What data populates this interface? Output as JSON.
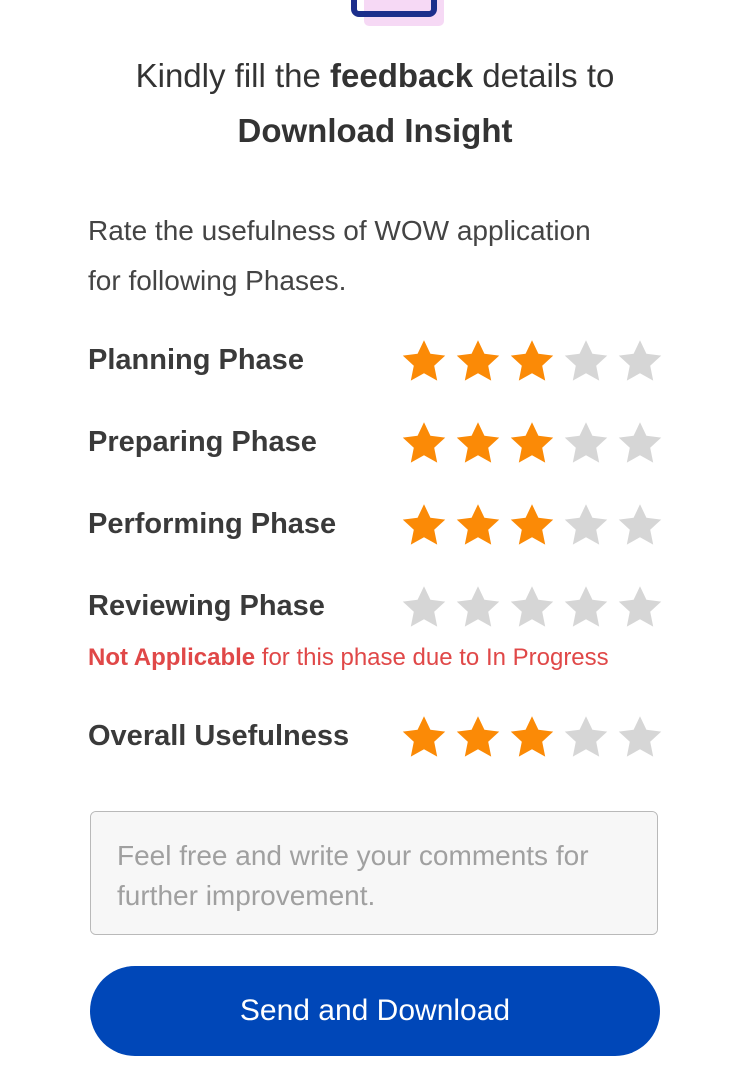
{
  "header": {
    "title_part1": "Kindly fill the ",
    "title_bold1": "feedback",
    "title_part2": " details to",
    "title_bold2": "Download Insight"
  },
  "prompt": {
    "line1": "Rate the usefulness of WOW application",
    "line2": "for following Phases."
  },
  "colors": {
    "star_filled": "#fb8a06",
    "star_empty": "#d6d6d6",
    "accent": "#0047b8",
    "note": "#e04848"
  },
  "ratings": [
    {
      "label": "Planning Phase",
      "rating": 3,
      "max": 5
    },
    {
      "label": "Preparing Phase",
      "rating": 3,
      "max": 5
    },
    {
      "label": "Performing Phase",
      "rating": 3,
      "max": 5
    },
    {
      "label": "Reviewing Phase",
      "rating": 0,
      "max": 5
    },
    {
      "label": "Overall Usefulness",
      "rating": 3,
      "max": 5
    }
  ],
  "reviewing_note": {
    "bold": "Not Applicable",
    "rest": " for this phase due to In Progress"
  },
  "comment": {
    "placeholder": "Feel free and write your comments for further improvement.",
    "value": ""
  },
  "submit_label": "Send and Download",
  "icons": {
    "top": "document-icon",
    "star": "star-icon"
  }
}
